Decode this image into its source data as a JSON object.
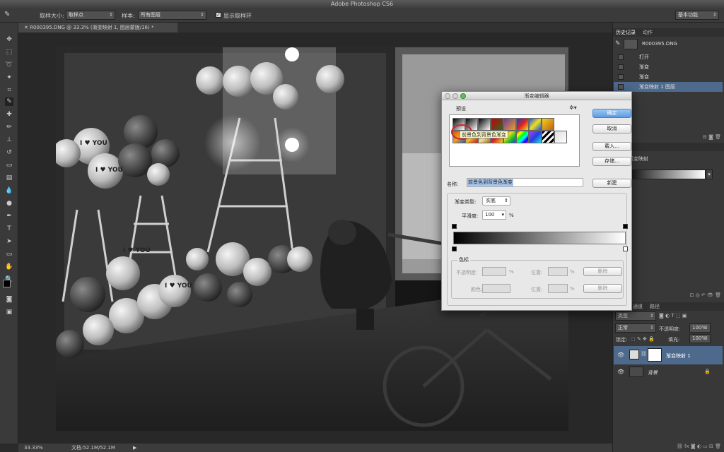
{
  "app": {
    "title": "Adobe Photoshop CS6",
    "workspace": "基本功能"
  },
  "options_bar": {
    "sample_size_label": "取样大小:",
    "sample_size_value": "取样点",
    "sample_label": "样本:",
    "sample_value": "所有图层",
    "show_ring_label": "显示取样环"
  },
  "document": {
    "tab_title": "R000395.DNG @ 33.3% (渐变映射 1, 图层蒙版/16) *",
    "zoom": "33.33%",
    "doc_size": "文档:52.1M/52.1M"
  },
  "history_panel": {
    "tabs": [
      "历史记录",
      "动作"
    ],
    "snapshot": "R000395.DNG",
    "items": [
      "打开",
      "渐变",
      "渐变",
      "渐变映射 1 图层"
    ]
  },
  "adjustments_panel": {
    "title": "渐变映射"
  },
  "layers_panel": {
    "tabs": [
      "图层",
      "通道",
      "路径"
    ],
    "kind_label": "类型",
    "blend_mode": "正常",
    "opacity_label": "不透明度:",
    "opacity_value": "100%",
    "lock_label": "锁定:",
    "fill_label": "填充:",
    "fill_value": "100%",
    "layers": [
      {
        "name": "渐变映射 1",
        "selected": true
      },
      {
        "name": "背景",
        "selected": false
      }
    ]
  },
  "gradient_editor": {
    "title": "渐变编辑器",
    "presets_label": "预设",
    "tooltip": "前景色到背景色渐变",
    "ok": "确定",
    "cancel": "取消",
    "load": "载入...",
    "save": "存储...",
    "name_label": "名称:",
    "name_value": "前景色到背景色渐变",
    "new_button": "新建",
    "type_label": "渐变类型:",
    "type_value": "实底",
    "smoothness_label": "平滑度:",
    "smoothness_value": "100",
    "smoothness_unit": "%",
    "stops_group": "色标",
    "opacity_label": "不透明度:",
    "location_label": "位置:",
    "percent": "%",
    "delete_label": "删除",
    "color_label": "颜色:"
  },
  "photo_text": {
    "balloon_1": "I ♥ YOU",
    "balloon_2": "I ♥ YOU",
    "balloon_3": "I ♥ YOU",
    "balloon_4": "I ♥ YOU"
  },
  "colors": {
    "accent": "#4a90d9",
    "highlight_circle": "#d42020",
    "selected_row": "#4d6a8c"
  }
}
